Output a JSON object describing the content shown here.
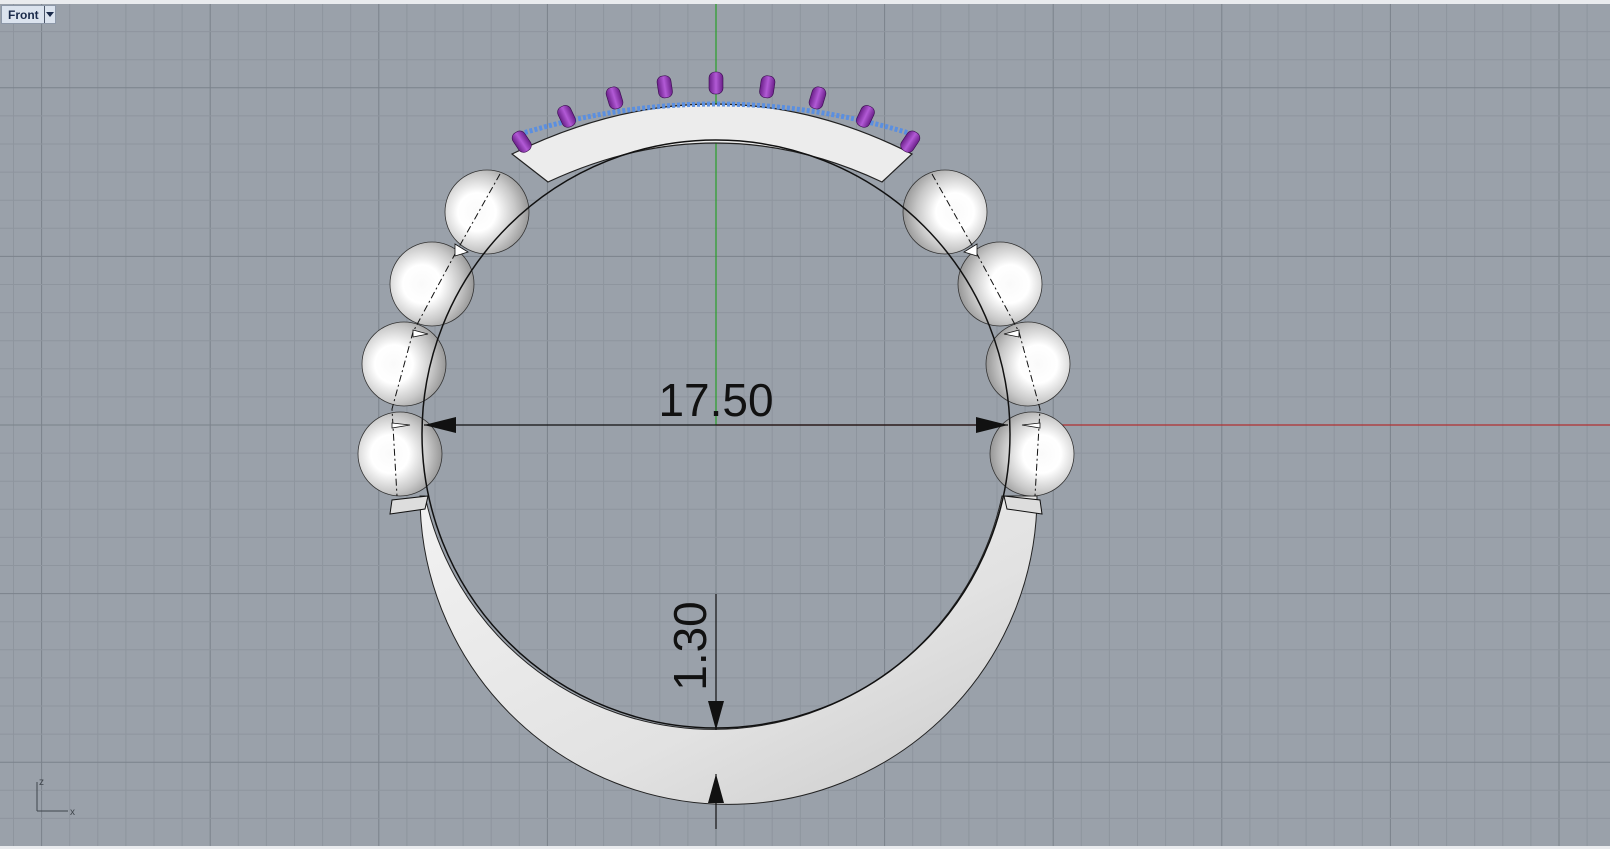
{
  "viewport": {
    "name": "Front",
    "colors": {
      "background": "#9aa1aa",
      "grid_minor": "#8e959e",
      "grid_major": "#7b828b",
      "x_axis": "#b03030",
      "y_axis": "#28a028",
      "gem": "#8d2fb0",
      "pave": "#5b8fe0",
      "metal": "#ececec"
    },
    "axis_icon": {
      "z_label": "z",
      "x_label": "x"
    },
    "dimensions": {
      "diameter": "17.50",
      "thickness": "1.30"
    }
  }
}
